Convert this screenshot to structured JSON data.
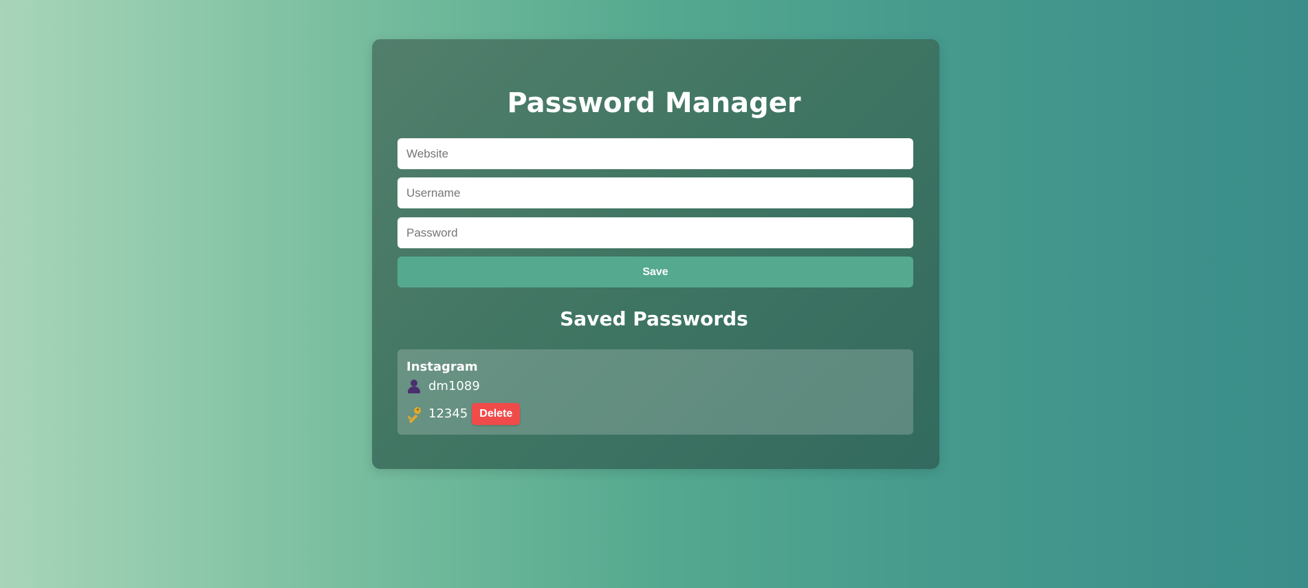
{
  "app": {
    "title": "Password Manager"
  },
  "form": {
    "website_placeholder": "Website",
    "username_placeholder": "Username",
    "password_placeholder": "Password",
    "website_value": "",
    "username_value": "",
    "password_value": "",
    "save_label": "Save"
  },
  "saved": {
    "heading": "Saved Passwords",
    "entries": [
      {
        "site": "Instagram",
        "username": "dm1089",
        "password": "12345",
        "user_icon": "user-icon",
        "key_icon": "key-icon",
        "delete_label": "Delete"
      }
    ]
  },
  "colors": {
    "accent": "#55a98f",
    "card": "#3f7562",
    "delete": "#f04a4a"
  }
}
